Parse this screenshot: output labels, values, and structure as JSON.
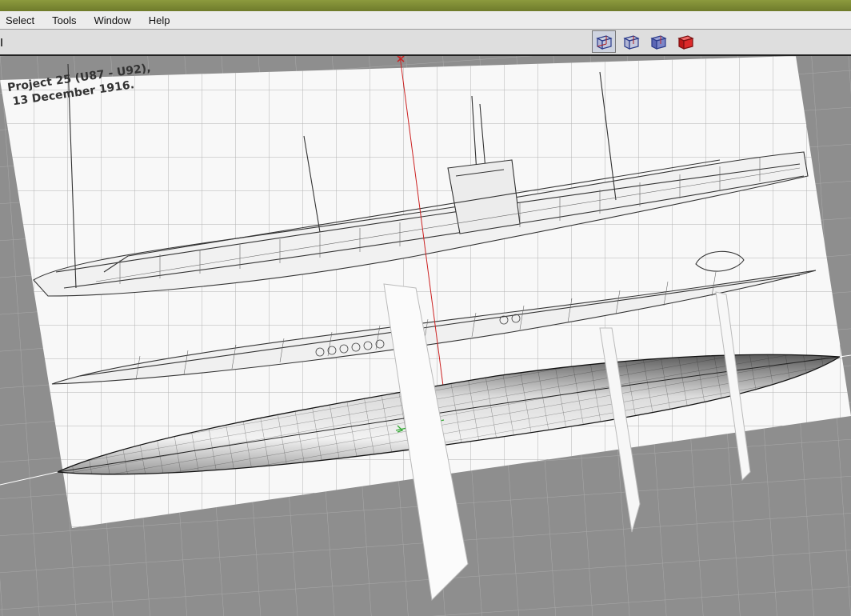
{
  "menu": {
    "items": [
      "Select",
      "Tools",
      "Window",
      "Help"
    ]
  },
  "toolbar": {
    "view_buttons": [
      {
        "icon": "cube-wire-icon",
        "selected": false
      },
      {
        "icon": "cube-wire-icon",
        "selected": false
      },
      {
        "icon": "cube-shaded-icon",
        "selected": false
      },
      {
        "icon": "cube-solid-red-icon",
        "selected": true
      }
    ]
  },
  "blueprint": {
    "caption_line1": "Project 25 (U87 - U92),",
    "caption_line2": "13 December 1916."
  },
  "colors": {
    "titlebar": "#7f8c35",
    "grid_floor": "#8e8e8e",
    "paper": "#f7f7f7",
    "axis_red": "#cc2222",
    "axis_green": "#33aa33"
  }
}
